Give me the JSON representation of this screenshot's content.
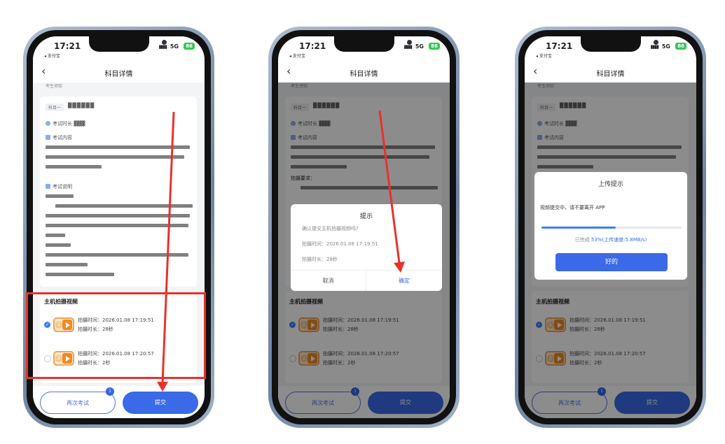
{
  "status": {
    "time": "17:21",
    "back_app": "◂ 支付宝",
    "signal": "▮▮▮▮",
    "network": "5G",
    "battery": "86"
  },
  "nav": {
    "back": "‹",
    "title": "科目详情",
    "crumb": "考生须知"
  },
  "subject": {
    "chip": "科目一",
    "name_blurred": "██████",
    "duration_label": "考试时长",
    "content_label": "考试内容",
    "notes_label": "考试说明",
    "shoot_requirement": "拍摄要求："
  },
  "video_section": {
    "title": "主机拍摄视频",
    "recordings": [
      {
        "index": "1",
        "time_label": "拍摄时间：",
        "time": "2026.01.08 17:19:51",
        "duration_label": "拍摄时长：",
        "duration": "28秒",
        "selected": true
      },
      {
        "index": "2",
        "time_label": "拍摄时间：",
        "time": "2026.01.08 17:20:57",
        "duration_label": "拍摄时长：",
        "duration": "2秒",
        "selected": false
      }
    ]
  },
  "buttons": {
    "retake": "再次考试",
    "retake_badge": "1",
    "submit": "提交"
  },
  "confirm_dialog": {
    "title": "提示",
    "question": "确认提交主机拍摄视频吗?",
    "time_label": "拍摄时间：",
    "time": "2026.01.08 17:19:51",
    "duration_label": "拍摄时长：",
    "duration": "28秒",
    "cancel": "取消",
    "ok": "确定"
  },
  "upload_dialog": {
    "title": "上传提示",
    "message": "视频提交中，请不要离开 APP",
    "progress_percent": 53,
    "done_label": "已完成 ",
    "done_value": "53%(上传速度:5.8MB/s)",
    "ok": "好的"
  },
  "colors": {
    "accent": "#3a6ae8",
    "highlight": "#e8322a",
    "play": "#ef8a24"
  }
}
